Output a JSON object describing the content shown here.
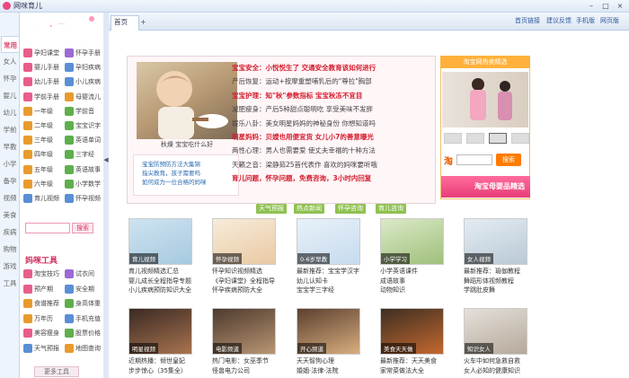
{
  "window": {
    "title": "网咪育儿",
    "minimize": "–",
    "maximize": "□",
    "close": "×"
  },
  "logo_text": "妈咪育儿",
  "sidebar": [
    {
      "label": "常用",
      "active": true
    },
    {
      "label": "女人"
    },
    {
      "label": "怀孕"
    },
    {
      "label": "婴儿"
    },
    {
      "label": "幼儿"
    },
    {
      "label": "学前"
    },
    {
      "label": "早教"
    },
    {
      "label": "小学"
    },
    {
      "label": "备孕"
    },
    {
      "label": "视频"
    },
    {
      "label": "美食"
    },
    {
      "label": "疾病"
    },
    {
      "label": "购物"
    },
    {
      "label": "游戏"
    },
    {
      "label": "工具"
    }
  ],
  "left_menu": [
    {
      "label": "孕妇课堂",
      "color": "#e85d8a"
    },
    {
      "label": "怀孕手册",
      "color": "#9b6ad3"
    },
    {
      "label": "婴儿手册",
      "color": "#e85d8a"
    },
    {
      "label": "孕妇疾病",
      "color": "#5a8fd6"
    },
    {
      "label": "幼儿手册",
      "color": "#e85d8a"
    },
    {
      "label": "小儿疾病",
      "color": "#5a8fd6"
    },
    {
      "label": "学前手册",
      "color": "#e85d8a"
    },
    {
      "label": "母婴流儿",
      "color": "#e89b2c"
    },
    {
      "label": "一年级",
      "color": "#e89b2c"
    },
    {
      "label": "学前音",
      "color": "#5fae4d"
    },
    {
      "label": "二年级",
      "color": "#e89b2c"
    },
    {
      "label": "宝宝识字",
      "color": "#5fae4d"
    },
    {
      "label": "三年级",
      "color": "#e89b2c"
    },
    {
      "label": "英语单词",
      "color": "#5fae4d"
    },
    {
      "label": "四年级",
      "color": "#e89b2c"
    },
    {
      "label": "三字经",
      "color": "#5fae4d"
    },
    {
      "label": "五年级",
      "color": "#e89b2c"
    },
    {
      "label": "英语故事",
      "color": "#5fae4d"
    },
    {
      "label": "六年级",
      "color": "#e89b2c"
    },
    {
      "label": "小学数学",
      "color": "#5fae4d"
    },
    {
      "label": "育儿视频",
      "color": "#5a8fd6"
    },
    {
      "label": "怀孕视频",
      "color": "#5a8fd6"
    }
  ],
  "search": {
    "button": "搜索",
    "value": ""
  },
  "tools_title": "妈咪工具",
  "tools": [
    {
      "label": "淘宝技巧",
      "color": "#e85d8a"
    },
    {
      "label": "试衣间",
      "color": "#9b6ad3"
    },
    {
      "label": "预产期",
      "color": "#e85d8a"
    },
    {
      "label": "安全期",
      "color": "#5a8fd6"
    },
    {
      "label": "食谱推荐",
      "color": "#e89b2c"
    },
    {
      "label": "身高体重",
      "color": "#5fae4d"
    },
    {
      "label": "万年历",
      "color": "#e89b2c"
    },
    {
      "label": "手机充值",
      "color": "#5a8fd6"
    },
    {
      "label": "美容瘦身",
      "color": "#e85d8a"
    },
    {
      "label": "股票价格",
      "color": "#5fae4d"
    },
    {
      "label": "天气预报",
      "color": "#5a8fd6"
    },
    {
      "label": "地图查询",
      "color": "#e89b2c"
    }
  ],
  "more_tools": "更多工具",
  "tab": {
    "label": "首页",
    "new": "+"
  },
  "top_links": [
    "首页链接",
    "建议反馈",
    "手机版",
    "网页版"
  ],
  "feature": {
    "caption": "秋燥  宝宝吃什么好",
    "tips": [
      "宝宝防预防方法大集锦",
      "指尖教育，孩子需要吗",
      "如何成为一位合格的妈咪"
    ],
    "news": [
      {
        "text": "宝宝安全：小悦悦生了 交通安全教育该如何进行",
        "highlight": true
      },
      {
        "text": "产后恢复：运动+按摩重塑哺乳后的\"尊拉\"胸部",
        "highlight": false
      },
      {
        "text": "宝宝护理：知\"秋\"参数指标 宝宝秋冻不宜目",
        "highlight": true
      },
      {
        "text": "减肥瘦身：产后5种甜点聪明吃 享受美味不发胖",
        "highlight": false
      },
      {
        "text": "娱乐八卦：美女明星妈妈的神秘身份 你想知道吗",
        "highlight": false
      },
      {
        "text": "明星妈妈：贝嫂也用便宜货 女儿小7的善意曝光",
        "highlight": true
      },
      {
        "text": "两性心理：男人也需要爱 使丈夫幸福的十种方法",
        "highlight": false
      },
      {
        "text": "天籁之音：梁静茹25首代表作 喜欢的妈咪要听哦",
        "highlight": false
      },
      {
        "text": "育儿问题，怀孕问题，免费咨询，3小时内回复",
        "highlight": true
      }
    ],
    "buttons": [
      "天气预报",
      "热点新闻",
      "怀孕咨询",
      "育儿咨询"
    ]
  },
  "ad": {
    "header": "淘宝网热卖精选",
    "tao": "淘",
    "search_btn": "搜索",
    "banner": "淘宝母婴品精选"
  },
  "cards": [
    {
      "label": "育儿视频",
      "lines": [
        "育儿视频精选汇总",
        "婴儿成长全程指导专题",
        "小儿疾病预防知识大全"
      ],
      "bg": "linear-gradient(160deg,#cfe3f1,#a6c9de)"
    },
    {
      "label": "怀孕视频",
      "lines": [
        "怀孕知识视频精选",
        "《孕妇课堂》全程指导",
        "怀孕疾病预防大全"
      ],
      "bg": "linear-gradient(160deg,#f7ecd9,#e9c9a4)"
    },
    {
      "label": "0-6岁早教",
      "lines": [
        "最新推荐：宝宝学汉字",
        "幼儿认知卡",
        "宝宝学三字经"
      ],
      "bg": "linear-gradient(160deg,#e8f1f9,#c6dbee)"
    },
    {
      "label": "小学学习",
      "lines": [
        "小学英语课件",
        "成语故事",
        "动物知识"
      ],
      "bg": "linear-gradient(160deg,#dbe9c8,#9fc07a)"
    },
    {
      "label": "女人视频",
      "lines": [
        "最新推荐：瑜伽教程",
        "舞蹈形体视频教程",
        "学跳肚皮舞"
      ],
      "bg": "linear-gradient(160deg,#e4ecf2,#b9c9d6)"
    },
    {
      "label": "明星视频",
      "lines": [
        "近期热播：倾世皇妃",
        "步步惊心（35集全）"
      ],
      "bg": "linear-gradient(160deg,#3b2a24,#a8734f)"
    },
    {
      "label": "电影频道",
      "lines": [
        "热门电影：女巫季节",
        "怪兽电力公司"
      ],
      "bg": "linear-gradient(160deg,#4d3a2e,#b99573)"
    },
    {
      "label": "开心频道",
      "lines": [
        "天天智狗心理",
        "婚姻·法律·法院"
      ],
      "bg": "linear-gradient(160deg,#5b4030,#d9ad7e)"
    },
    {
      "label": "美食天天做",
      "lines": [
        "最新推荐：天天美食",
        "家常菜做法大全"
      ],
      "bg": "linear-gradient(160deg,#3d2f23,#c4682e)"
    },
    {
      "label": "知识女人",
      "lines": [
        "火车中如何急救自救",
        "女人必知的健康知识"
      ],
      "bg": "linear-gradient(160deg,#e5e0da,#b5a99a)"
    }
  ]
}
